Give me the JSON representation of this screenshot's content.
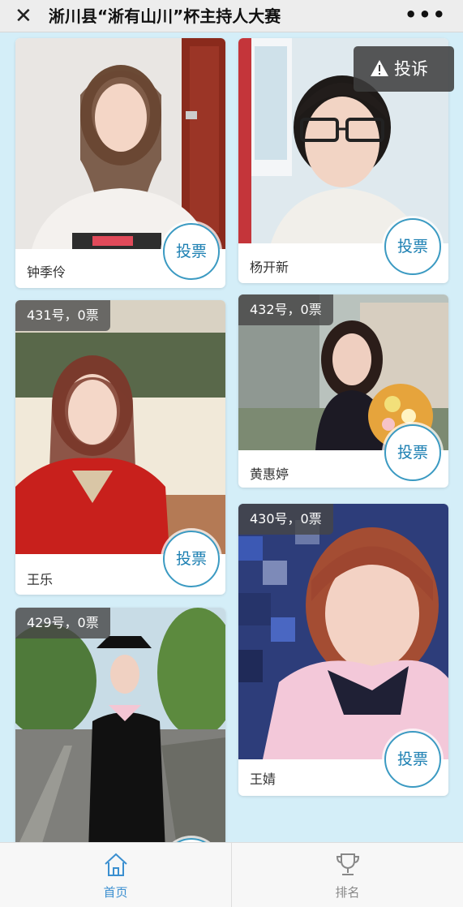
{
  "header": {
    "title": "淅川县“淅有山川”杯主持人大赛",
    "close_icon": "close-icon",
    "more_icon": "more-icon"
  },
  "complain_button": {
    "label": "投诉",
    "icon": "warning-icon"
  },
  "vote_label": "投票",
  "contestants": [
    {
      "name": "钟季伶"
    },
    {
      "name": "杨开新"
    },
    {
      "name": "王乐",
      "badge": "431号，0票"
    },
    {
      "name": "黄惠婷",
      "badge": "432号，0票"
    },
    {
      "name": "王婧",
      "badge": "430号，0票"
    },
    {
      "badge": "429号，0票"
    }
  ],
  "tabbar": {
    "home": {
      "label": "首页",
      "icon": "home-icon"
    },
    "rank": {
      "label": "排名",
      "icon": "trophy-icon"
    }
  },
  "colors": {
    "background": "#d4eef8",
    "vote_border": "#3b9ac2",
    "active_tab": "#3b8fd0"
  }
}
